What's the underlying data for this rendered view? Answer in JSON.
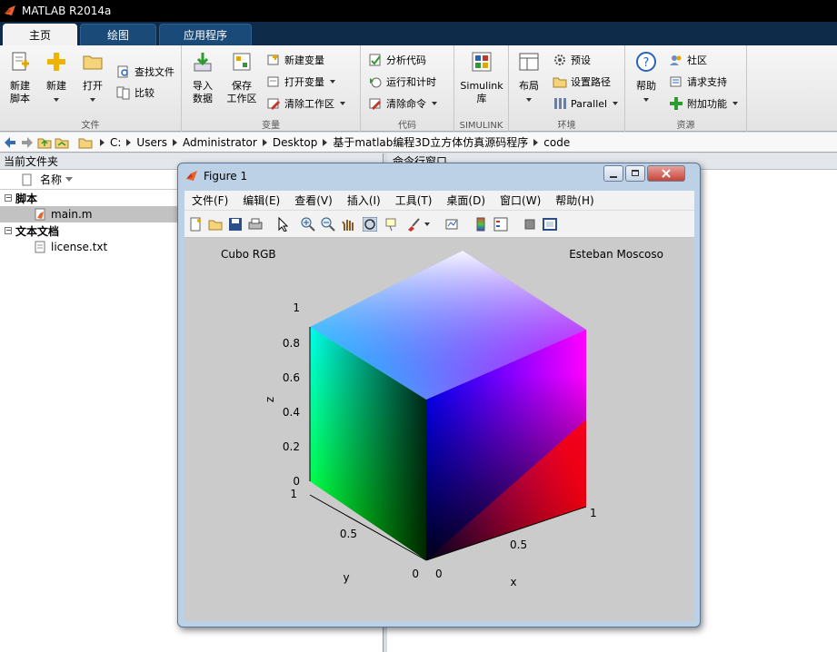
{
  "app": {
    "title": "MATLAB R2014a"
  },
  "tabs": [
    {
      "label": "主页",
      "active": true
    },
    {
      "label": "绘图",
      "active": false
    },
    {
      "label": "应用程序",
      "active": false
    }
  ],
  "ribbon": {
    "file": {
      "new_script": "新建\n脚本",
      "new": "新建",
      "open": "打开",
      "find_files": "查找文件",
      "compare": "比较",
      "group": "文件"
    },
    "variable": {
      "import_data": "导入\n数据",
      "save_workspace": "保存\n工作区",
      "new_variable": "新建变量",
      "open_variable": "打开变量",
      "clear_workspace": "清除工作区",
      "group": "变量"
    },
    "code": {
      "analyze_code": "分析代码",
      "run_and_time": "运行和计时",
      "clear_commands": "清除命令",
      "group": "代码"
    },
    "simulink": {
      "library": "Simulink\n库",
      "group": "SIMULINK"
    },
    "environment": {
      "layout": "布局",
      "preferences": "预设",
      "set_path": "设置路径",
      "parallel": "Parallel",
      "group": "环境"
    },
    "resources": {
      "help": "帮助",
      "community": "社区",
      "request_support": "请求支持",
      "add_ons": "附加功能",
      "group": "资源"
    }
  },
  "address": {
    "crumbs": [
      "C:",
      "Users",
      "Administrator",
      "Desktop",
      "基于matlab编程3D立方体仿真源码程序",
      "code"
    ]
  },
  "current_folder": {
    "title": "当前文件夹",
    "column_name": "名称",
    "groups": [
      {
        "label": "脚本",
        "files": [
          "main.m"
        ]
      },
      {
        "label": "文本文档",
        "files": [
          "license.txt"
        ]
      }
    ]
  },
  "command_window": {
    "title": "命令行窗口"
  },
  "figure": {
    "title": "Figure 1",
    "menu": [
      "文件(F)",
      "编辑(E)",
      "查看(V)",
      "插入(I)",
      "工具(T)",
      "桌面(D)",
      "窗口(W)",
      "帮助(H)"
    ],
    "text_left": "Cubo RGB",
    "text_right": "Esteban Moscoso",
    "axes": {
      "xlabel": "x",
      "ylabel": "y",
      "zlabel": "z",
      "z_ticks": [
        "0",
        "0.2",
        "0.4",
        "0.6",
        "0.8",
        "1"
      ],
      "x_ticks": [
        "0",
        "0.5",
        "1"
      ],
      "y_ticks": [
        "0",
        "0.5",
        "1"
      ]
    }
  }
}
